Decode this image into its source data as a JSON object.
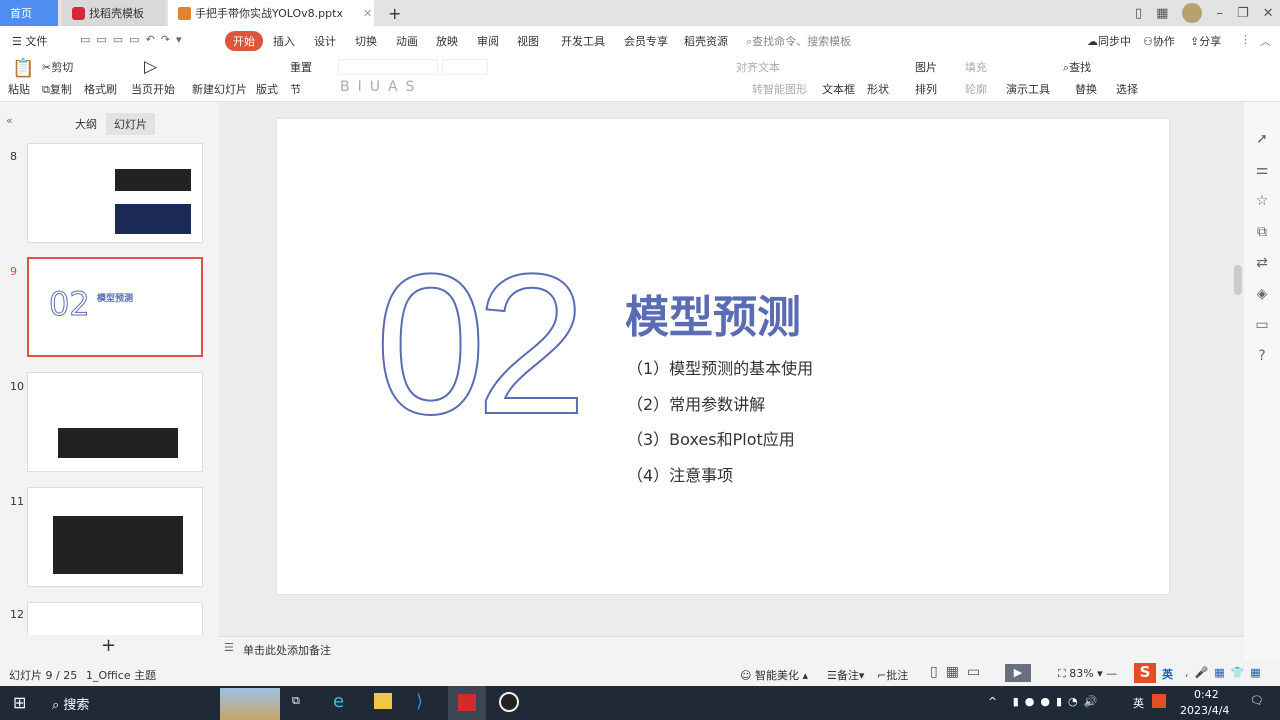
{
  "tabs": [
    {
      "label": "首页"
    },
    {
      "label": "找稻壳模板"
    },
    {
      "label": "手把手带你实战YOLOv8.pptx"
    }
  ],
  "menu": {
    "file": "文件",
    "items": [
      "开始",
      "插入",
      "设计",
      "切换",
      "动画",
      "放映",
      "审阅",
      "视图",
      "开发工具",
      "会员专享",
      "稻壳资源"
    ],
    "search_placeholder": "查找命令、搜索模板",
    "sync": "同步中",
    "collab": "协作",
    "share": "分享"
  },
  "ribbon": {
    "paste": "粘贴",
    "cut": "剪切",
    "copy": "复制",
    "format_painter": "格式刷",
    "play_current": "当页开始",
    "new_slide": "新建幻灯片",
    "layout": "版式",
    "reset": "重置",
    "section": "节",
    "align_text": "对齐文本",
    "smart_shape": "转智能图形",
    "textbox": "文本框",
    "shape": "形状",
    "picture": "图片",
    "fill": "填充",
    "arrange": "排列",
    "outline": "轮廓",
    "present_tools": "演示工具",
    "find": "查找",
    "replace": "替换",
    "select": "选择"
  },
  "left_panel": {
    "tab_outline": "大纲",
    "tab_slides": "幻灯片",
    "slides": [
      {
        "num": "8"
      },
      {
        "num": "9",
        "title": "模型预测",
        "big": "02"
      },
      {
        "num": "10"
      },
      {
        "num": "11"
      },
      {
        "num": "12"
      }
    ]
  },
  "slide": {
    "number": "02",
    "title": "模型预测",
    "items": [
      "（1）模型预测的基本使用",
      "（2）常用参数讲解",
      "（3）Boxes和Plot应用",
      "（4）注意事项"
    ]
  },
  "notes": {
    "placeholder": "单击此处添加备注"
  },
  "status": {
    "slide_count": "幻灯片 9 / 25",
    "theme": "1_Office 主题",
    "beautify": "智能美化",
    "notes": "备注",
    "comment": "批注",
    "zoom": "83%",
    "ime": "英"
  },
  "taskbar": {
    "search": "搜索",
    "time": "0:42",
    "date": "2023/4/4",
    "ime": "英"
  },
  "colors": {
    "accent": "#e0533c",
    "slide_blue": "#5a6cb3"
  }
}
